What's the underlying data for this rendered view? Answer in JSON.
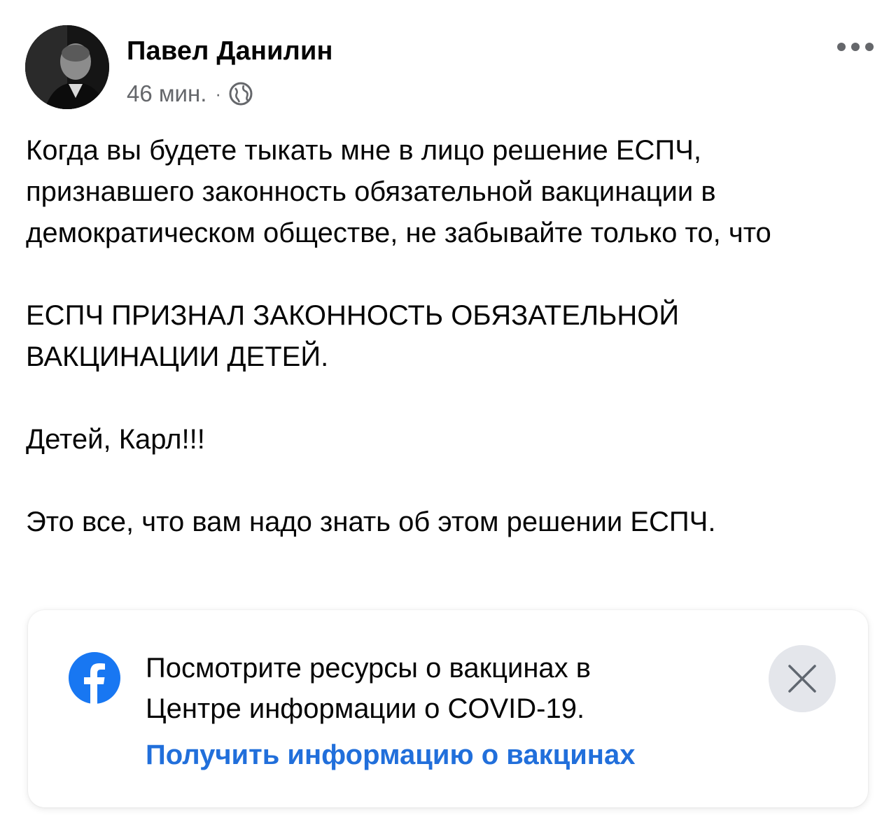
{
  "post": {
    "author": "Павел Данилин",
    "time": "46 мин.",
    "separator": "·",
    "privacy_icon": "globe-icon",
    "menu_icon": "more-options-icon",
    "paragraphs": [
      "Когда вы будете тыкать мне в лицо решение ЕСПЧ, признавшего законность обязательной вакцинации в демократическом обществе, не забывайте только то, что",
      "ЕСПЧ ПРИЗНАЛ ЗАКОНHOСТЬ ОБЯЗАТЕЛЬНОЙ ВАКЦИНАЦИИ ДЕТЕЙ.",
      "Детей, Карл!!!",
      "Это все, что вам надо знать об этом решении ЕСПЧ."
    ]
  },
  "covid_card": {
    "logo_icon": "facebook-logo-icon",
    "text_line1": "Посмотрите ресурсы о вакцинах в",
    "text_line2": "Центре информации о COVID-19.",
    "link": "Получить информацию о вакцинах",
    "close_icon": "close-icon",
    "link_color": "#216fdb",
    "logo_color": "#1877f2"
  }
}
